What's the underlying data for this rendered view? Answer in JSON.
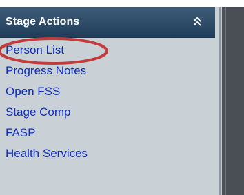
{
  "header": {
    "title": "Stage Actions",
    "collapse_icon": "double-chevron-up-icon"
  },
  "items": [
    {
      "label": "Person List"
    },
    {
      "label": "Progress Notes"
    },
    {
      "label": "Open FSS"
    },
    {
      "label": "Stage Comp"
    },
    {
      "label": "FASP"
    },
    {
      "label": "Health Services"
    }
  ],
  "colors": {
    "header_bg": "#2f4d69",
    "panel_bg": "#c9d1d7",
    "link": "#0f2ec4",
    "highlight": "#c33c3c"
  }
}
